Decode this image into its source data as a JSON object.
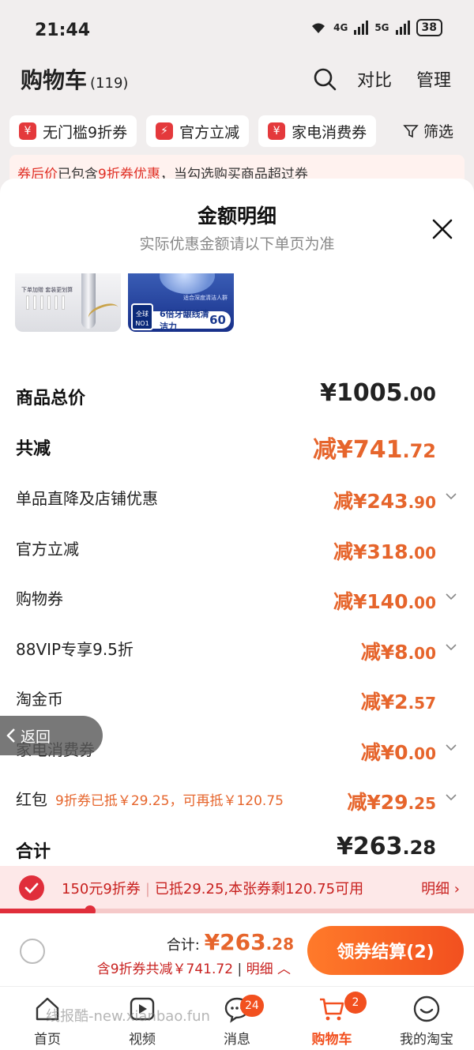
{
  "status": {
    "time": "21:44",
    "net1": "4G",
    "net2": "5G",
    "battery": "38"
  },
  "header": {
    "title": "购物车",
    "count": "(119)",
    "compare": "对比",
    "manage": "管理"
  },
  "chips": [
    "无门槛9折券",
    "官方立减",
    "家电消费券"
  ],
  "filter": "筛选",
  "notice": {
    "red1": "券后价",
    "t1": "已包含",
    "red2": "9折券优惠",
    "t2": "，当勾选购买商品超过券"
  },
  "panel": {
    "title": "金额明细",
    "subtitle": "实际优惠金额请以下单页为准",
    "thumb1": {
      "caption": "下单加赠 套装更划算"
    },
    "thumb2": {
      "label": "适合深度清洁人群",
      "badge": "全球 NO1",
      "text": "6倍牙龈线清洁力",
      "num": "60"
    },
    "rows": [
      {
        "label": "商品总价",
        "int": "¥1005",
        "dec": ".00"
      },
      {
        "label": "共减",
        "int": "减¥741",
        "dec": ".72"
      },
      {
        "label": "单品直降及店铺优惠",
        "int": "减¥243",
        "dec": ".90"
      },
      {
        "label": "官方立减",
        "int": "减¥318",
        "dec": ".00"
      },
      {
        "label": "购物券",
        "int": "减¥140",
        "dec": ".00"
      },
      {
        "label": "88VIP专享9.5折",
        "int": "减¥8",
        "dec": ".00"
      },
      {
        "label": "淘金币",
        "int": "减¥2",
        "dec": ".57"
      },
      {
        "label": "家电消费券",
        "int": "减¥0",
        "dec": ".00"
      },
      {
        "label": "红包",
        "note": "9折券已抵￥29.25，可再抵￥120.75",
        "int": "减¥29",
        "dec": ".25"
      },
      {
        "label": "合计",
        "int": "¥263",
        "dec": ".28"
      }
    ]
  },
  "back": "返回",
  "coupon": {
    "name": "150元9折券",
    "desc": "已抵29.25,本张券剩120.75可用",
    "detail": "明细",
    "progress": 0.19
  },
  "checkout": {
    "total_label": "合计:",
    "total_int": "¥263",
    "total_dec": ".28",
    "save": "含9折券共减￥741.72",
    "detail": "明细",
    "pay": "领券结算(2)"
  },
  "tabs": [
    {
      "label": "首页"
    },
    {
      "label": "视频"
    },
    {
      "label": "消息",
      "badge": "24"
    },
    {
      "label": "购物车",
      "badge": "2"
    },
    {
      "label": "我的淘宝"
    }
  ],
  "watermark": "线报酷-new.xianbao.fun"
}
